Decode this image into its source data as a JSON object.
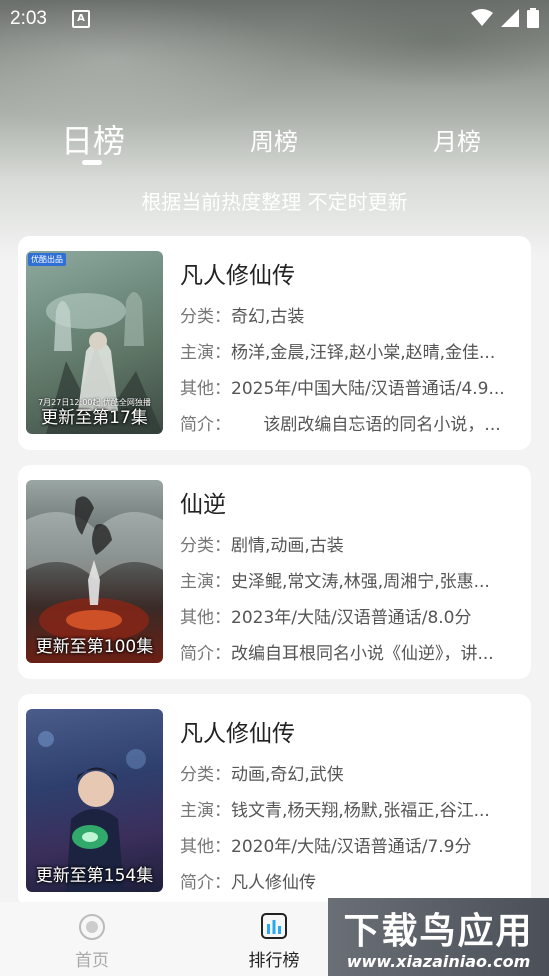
{
  "status_bar": {
    "time": "2:03",
    "notif_glyph": "A"
  },
  "tabs": [
    {
      "label": "日榜"
    },
    {
      "label": "周榜"
    },
    {
      "label": "月榜"
    }
  ],
  "subtitle": "根据当前热度整理 不定时更新",
  "list": [
    {
      "title": "凡人修仙传",
      "episode": "更新至第17集",
      "category_key": "分类：",
      "category": "奇幻,古装",
      "cast_key": "主演：",
      "cast": "杨洋,金晨,汪铎,赵小棠,赵晴,金佳...",
      "other_key": "其他：",
      "other": "2025年/中国大陆/汉语普通话/4.9...",
      "intro_key": "简介：",
      "intro": "      该剧改编自忘语的同名小说，...",
      "poster_badge": "优酷出品",
      "poster_caption": "7月27日12:00起 优酷全网独播"
    },
    {
      "title": "仙逆",
      "episode": "更新至第100集",
      "category_key": "分类：",
      "category": "剧情,动画,古装",
      "cast_key": "主演：",
      "cast": "史泽鲲,常文涛,林强,周湘宁,张惠...",
      "other_key": "其他：",
      "other": "2023年/大陆/汉语普通话/8.0分",
      "intro_key": "简介：",
      "intro": "改编自耳根同名小说《仙逆》，讲..."
    },
    {
      "title": "凡人修仙传",
      "episode": "更新至第154集",
      "category_key": "分类：",
      "category": "动画,奇幻,武侠",
      "cast_key": "主演：",
      "cast": "钱文青,杨天翔,杨默,张福正,谷江...",
      "other_key": "其他：",
      "other": "2020年/大陆/汉语普通话/7.9分",
      "intro_key": "简介：",
      "intro": "凡人修仙传"
    }
  ],
  "bottom_nav": {
    "home": {
      "label": "首页",
      "icon": "home-icon"
    },
    "rank": {
      "label": "排行榜",
      "icon": "ranking-icon"
    }
  },
  "watermark": {
    "top": "下载鸟应用",
    "bottom": "www.xiazainiao.com"
  }
}
